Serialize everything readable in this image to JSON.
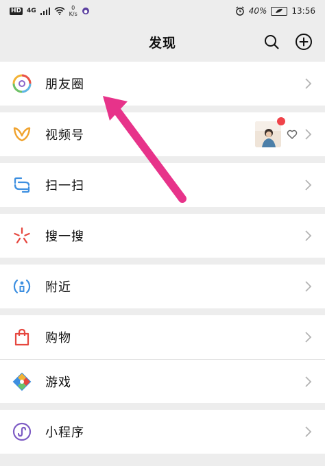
{
  "status_bar": {
    "network_badge": "HD",
    "signal": "4G",
    "speed_value": "0",
    "speed_unit": "K/s",
    "battery_percent": "40%",
    "time": "13:56"
  },
  "header": {
    "title": "发现"
  },
  "items": [
    {
      "label": "朋友圈",
      "icon": "moments-icon"
    },
    {
      "label": "视频号",
      "icon": "channels-icon"
    },
    {
      "label": "扫一扫",
      "icon": "scan-icon"
    },
    {
      "label": "搜一搜",
      "icon": "search-spark-icon"
    },
    {
      "label": "附近",
      "icon": "nearby-icon"
    },
    {
      "label": "购物",
      "icon": "shopping-bag-icon"
    },
    {
      "label": "游戏",
      "icon": "game-icon"
    },
    {
      "label": "小程序",
      "icon": "mini-program-icon"
    }
  ],
  "colors": {
    "background": "#ededed",
    "row": "#ffffff",
    "annotation_arrow": "#e7338a",
    "badge_red": "#f0434a"
  }
}
